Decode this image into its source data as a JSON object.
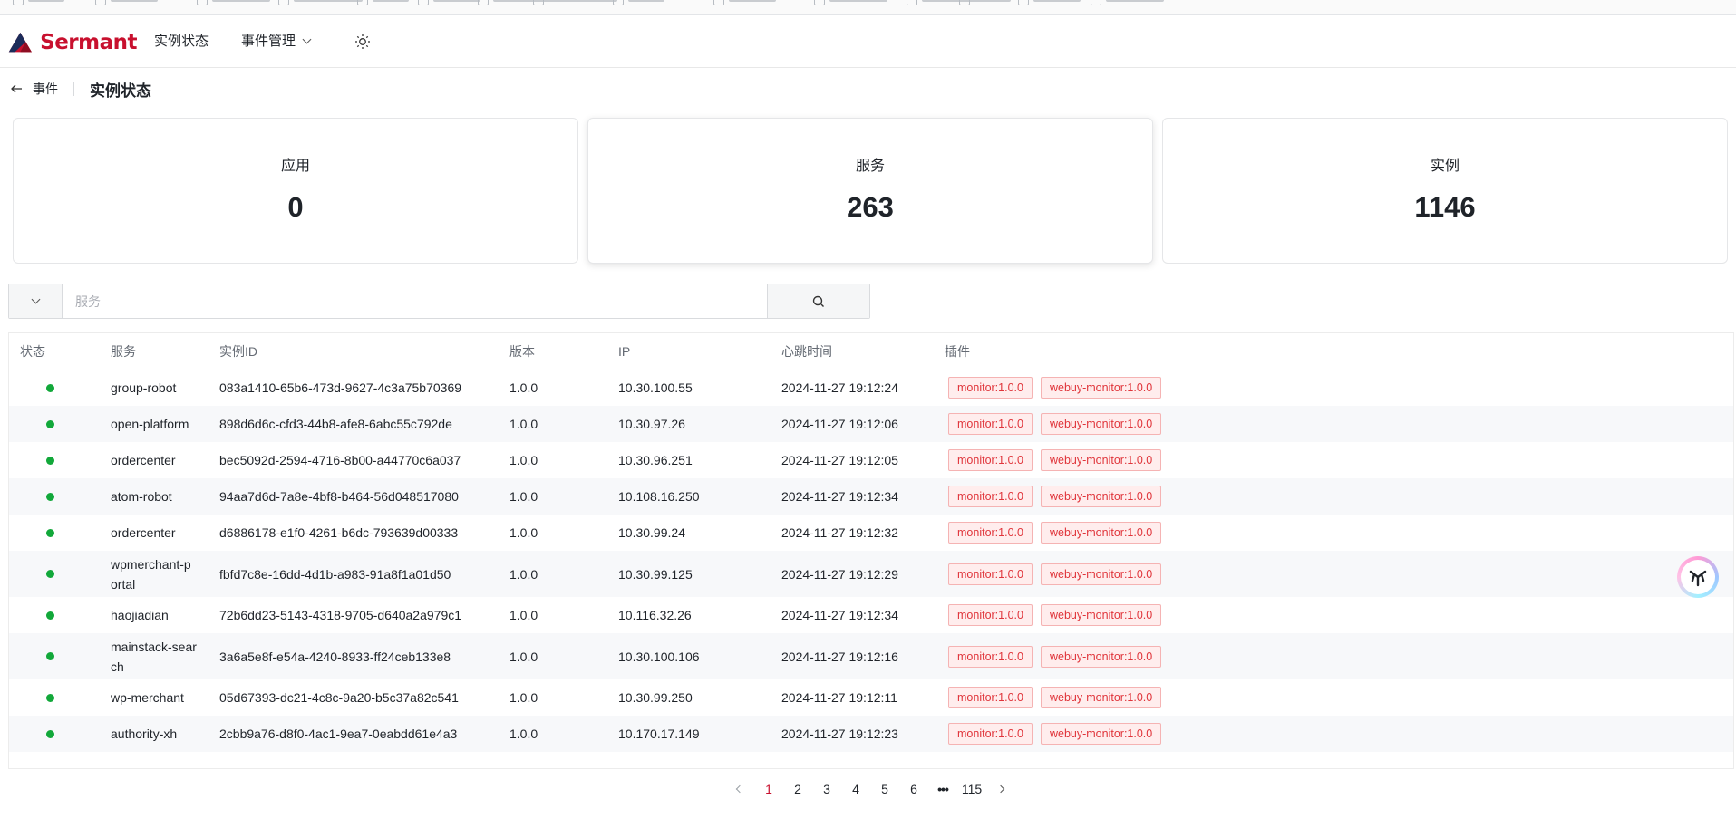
{
  "header": {
    "brand": "Sermant",
    "nav": [
      {
        "label": "实例状态"
      },
      {
        "label": "事件管理"
      }
    ],
    "theme_icon": "sun-icon"
  },
  "breadcrumb": {
    "back_label": "事件",
    "title": "实例状态"
  },
  "stats": [
    {
      "label": "应用",
      "value": "0"
    },
    {
      "label": "服务",
      "value": "263"
    },
    {
      "label": "实例",
      "value": "1146"
    }
  ],
  "search": {
    "placeholder": "服务",
    "icon": "search-icon"
  },
  "table": {
    "columns": [
      "状态",
      "服务",
      "实例ID",
      "版本",
      "IP",
      "心跳时间",
      "插件"
    ],
    "rows": [
      {
        "status": "online",
        "service": "group-robot",
        "instance_id": "083a1410-65b6-473d-9627-4c3a75b70369",
        "version": "1.0.0",
        "ip": "10.30.100.55",
        "heartbeat": "2024-11-27 19:12:24",
        "plugins": [
          "monitor:1.0.0",
          "webuy-monitor:1.0.0"
        ]
      },
      {
        "status": "online",
        "service": "open-platform",
        "instance_id": "898d6d6c-cfd3-44b8-afe8-6abc55c792de",
        "version": "1.0.0",
        "ip": "10.30.97.26",
        "heartbeat": "2024-11-27 19:12:06",
        "plugins": [
          "monitor:1.0.0",
          "webuy-monitor:1.0.0"
        ]
      },
      {
        "status": "online",
        "service": "ordercenter",
        "instance_id": "bec5092d-2594-4716-8b00-a44770c6a037",
        "version": "1.0.0",
        "ip": "10.30.96.251",
        "heartbeat": "2024-11-27 19:12:05",
        "plugins": [
          "monitor:1.0.0",
          "webuy-monitor:1.0.0"
        ]
      },
      {
        "status": "online",
        "service": "atom-robot",
        "instance_id": "94aa7d6d-7a8e-4bf8-b464-56d048517080",
        "version": "1.0.0",
        "ip": "10.108.16.250",
        "heartbeat": "2024-11-27 19:12:34",
        "plugins": [
          "monitor:1.0.0",
          "webuy-monitor:1.0.0"
        ]
      },
      {
        "status": "online",
        "service": "ordercenter",
        "instance_id": "d6886178-e1f0-4261-b6dc-793639d00333",
        "version": "1.0.0",
        "ip": "10.30.99.24",
        "heartbeat": "2024-11-27 19:12:32",
        "plugins": [
          "monitor:1.0.0",
          "webuy-monitor:1.0.0"
        ]
      },
      {
        "status": "online",
        "service": "wpmerchant-portal",
        "instance_id": "fbfd7c8e-16dd-4d1b-a983-91a8f1a01d50",
        "version": "1.0.0",
        "ip": "10.30.99.125",
        "heartbeat": "2024-11-27 19:12:29",
        "plugins": [
          "monitor:1.0.0",
          "webuy-monitor:1.0.0"
        ]
      },
      {
        "status": "online",
        "service": "haojiadian",
        "instance_id": "72b6dd23-5143-4318-9705-d640a2a979c1",
        "version": "1.0.0",
        "ip": "10.116.32.26",
        "heartbeat": "2024-11-27 19:12:34",
        "plugins": [
          "monitor:1.0.0",
          "webuy-monitor:1.0.0"
        ]
      },
      {
        "status": "online",
        "service": "mainstack-search",
        "instance_id": "3a6a5e8f-e54a-4240-8933-ff24ceb133e8",
        "version": "1.0.0",
        "ip": "10.30.100.106",
        "heartbeat": "2024-11-27 19:12:16",
        "plugins": [
          "monitor:1.0.0",
          "webuy-monitor:1.0.0"
        ]
      },
      {
        "status": "online",
        "service": "wp-merchant",
        "instance_id": "05d67393-dc21-4c8c-9a20-b5c37a82c541",
        "version": "1.0.0",
        "ip": "10.30.99.250",
        "heartbeat": "2024-11-27 19:12:11",
        "plugins": [
          "monitor:1.0.0",
          "webuy-monitor:1.0.0"
        ]
      },
      {
        "status": "online",
        "service": "authority-xh",
        "instance_id": "2cbb9a76-d8f0-4ac1-9ea7-0eabdd61e4a3",
        "version": "1.0.0",
        "ip": "10.170.17.149",
        "heartbeat": "2024-11-27 19:12:23",
        "plugins": [
          "monitor:1.0.0",
          "webuy-monitor:1.0.0"
        ]
      }
    ]
  },
  "pagination": {
    "pages": [
      "1",
      "2",
      "3",
      "4",
      "5",
      "6"
    ],
    "current": "1",
    "ellipsis": "•••",
    "last": "115"
  },
  "colors": {
    "brand": "#c8102e",
    "status_online": "#12a83a",
    "tag_text": "#e0343a",
    "tag_bg": "#ffeded"
  },
  "floating_assistant_icon": "assistant-logo-icon"
}
